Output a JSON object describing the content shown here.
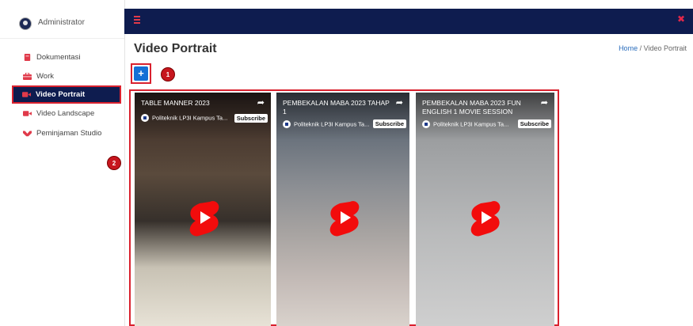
{
  "profile": {
    "name": "Administrator"
  },
  "sidebar": {
    "items": [
      {
        "label": "Dokumentasi",
        "icon": "book-icon",
        "color": "#e03a4a"
      },
      {
        "label": "Work",
        "icon": "briefcase-icon",
        "color": "#e03a4a"
      },
      {
        "label": "Video Portrait",
        "icon": "video-camera-icon",
        "color": "#e03a4a",
        "active": true
      },
      {
        "label": "Video Landscape",
        "icon": "video-camera-icon",
        "color": "#e03a4a"
      },
      {
        "label": "Peminjaman Studio",
        "icon": "handshake-icon",
        "color": "#e03a4a"
      }
    ]
  },
  "header": {
    "menu_icon": "hamburger-icon",
    "close_icon": "close-icon"
  },
  "page": {
    "title": "Video Portrait",
    "breadcrumb": {
      "home": "Home",
      "separator": "/",
      "current": "Video Portrait"
    },
    "add_button_label": "+"
  },
  "callouts": [
    "1",
    "2"
  ],
  "videos": [
    {
      "title": "TABLE MANNER 2023",
      "channel": "Politeknik LP3I Kampus Ta...",
      "subscribe": "Subscribe"
    },
    {
      "title": "PEMBEKALAN MABA 2023 TAHAP 1",
      "channel": "Politeknik LP3I Kampus Ta...",
      "subscribe": "Subscribe"
    },
    {
      "title": "PEMBEKALAN MABA 2023 FUN ENGLISH 1 MOVIE SESSION",
      "channel": "Politeknik LP3I Kampus Ta...",
      "subscribe": "Subscribe"
    }
  ],
  "colors": {
    "navy": "#0e1c4f",
    "accent_red": "#d9212e",
    "primary_blue": "#1470d6"
  }
}
